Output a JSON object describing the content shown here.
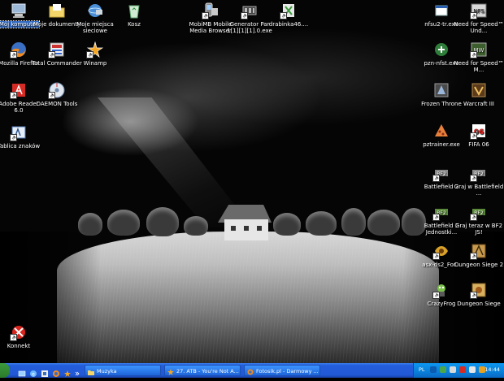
{
  "desktop": {
    "icons_left": [
      {
        "label": "Mój komputer",
        "icon": "computer-icon"
      },
      {
        "label": "Moje dokumenty",
        "icon": "folder-documents-icon"
      },
      {
        "label": "Moje miejsca sieciowe",
        "icon": "network-places-icon"
      },
      {
        "label": "Kosz",
        "icon": "recycle-bin-icon"
      },
      {
        "label": "Mozilla Firefox",
        "icon": "firefox-icon"
      },
      {
        "label": "Total Commander",
        "icon": "total-commander-icon"
      },
      {
        "label": "Winamp",
        "icon": "winamp-icon"
      },
      {
        "label": "Adobe Reader 6.0",
        "icon": "adobe-reader-icon"
      },
      {
        "label": "DAEMON Tools",
        "icon": "daemon-tools-icon"
      },
      {
        "label": "Tablica znaków",
        "icon": "character-map-icon"
      },
      {
        "label": "Konnekt",
        "icon": "konnekt-icon"
      }
    ],
    "icons_top_center": [
      {
        "label": "MobiMB Mobile Media Browser",
        "icon": "mobimb-icon"
      },
      {
        "label": "Generator Par 1[1][1][1].0.exe",
        "icon": "generator-icon"
      },
      {
        "label": "drabinka46....",
        "icon": "drabinka-icon"
      }
    ],
    "icons_right": [
      {
        "label": "nfsu2-tr.exe",
        "icon": "exe-file-icon"
      },
      {
        "label": "Need for Speed™ Und...",
        "icon": "nfs-underground-icon"
      },
      {
        "label": "pzn-nfst.exe",
        "icon": "exe-file-icon"
      },
      {
        "label": "Need for Speed™ M...",
        "icon": "nfs-mostwanted-icon"
      },
      {
        "label": "Frozen Throne",
        "icon": "frozen-throne-icon"
      },
      {
        "label": "Warcraft III",
        "icon": "warcraft-icon"
      },
      {
        "label": "pztrainer.exe",
        "icon": "trainer-icon"
      },
      {
        "label": "FIFA 06",
        "icon": "fifa-icon"
      },
      {
        "label": "Battlefield 2",
        "icon": "battlefield-icon"
      },
      {
        "label": "Graj w Battlefield ...",
        "icon": "battlefield-icon"
      },
      {
        "label": "Battlefield 2 Jednostki...",
        "icon": "battlefield-icon"
      },
      {
        "label": "Graj teraz w BF2 JS!",
        "icon": "battlefield-icon"
      },
      {
        "label": "asx-ds2_For...",
        "icon": "dungeon-siege-icon"
      },
      {
        "label": "Dungeon Siege 2",
        "icon": "dungeon-siege-icon"
      },
      {
        "label": "CrazyFrog",
        "icon": "crazyfrog-icon"
      },
      {
        "label": "Dungeon Siege",
        "icon": "dungeon-siege-icon"
      }
    ]
  },
  "taskbar": {
    "tasks": [
      {
        "label": "Muzyka",
        "icon": "folder-icon"
      },
      {
        "label": "27. ATB - You're Not A...",
        "icon": "winamp-icon"
      },
      {
        "label": "Fotosik.pl - Darmowy ...",
        "icon": "firefox-icon"
      }
    ],
    "tray": {
      "language": "PL",
      "clock": "14:44"
    }
  },
  "colors": {
    "taskbar": "#245edb",
    "tray": "#0c96f0",
    "selection": "#316ac5"
  }
}
